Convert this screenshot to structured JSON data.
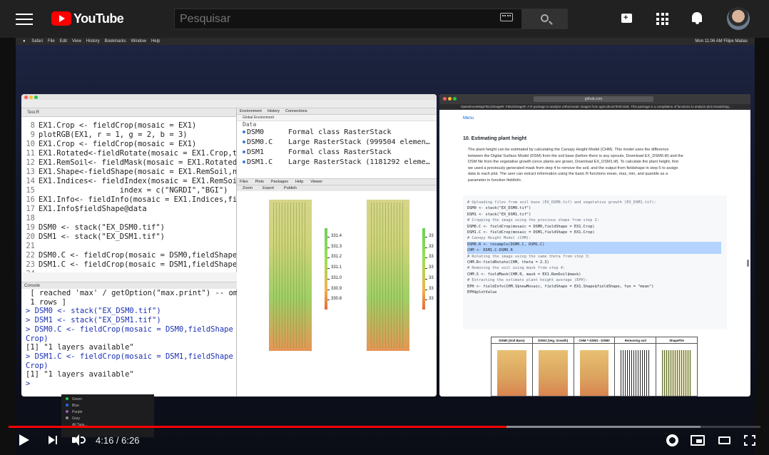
{
  "header": {
    "logo_text": "YouTube",
    "search_placeholder": "Pesquisar",
    "icons": [
      "menu-icon",
      "keyboard-icon",
      "search-icon",
      "create-video-icon",
      "apps-icon",
      "notifications-bell-icon",
      "avatar"
    ]
  },
  "mac": {
    "menubar_items": [
      "Safari",
      "File",
      "Edit",
      "View",
      "History",
      "Bookmarks",
      "Window",
      "Help"
    ],
    "clock": "Mon 11:06 AM  Filipe Matias"
  },
  "rstudio": {
    "editor_tab": "Test.R",
    "code_lines": [
      {
        "n": "8",
        "t": "EX1.Crop <- fieldCrop(mosaic = EX1)"
      },
      {
        "n": "9",
        "t": "plotRGB(EX1, r = 1, g = 2, b = 3)"
      },
      {
        "n": "10",
        "t": "EX1.Crop <- fieldCrop(mosaic = EX1)"
      },
      {
        "n": "11",
        "t": "EX1.Rotated<-fieldRotate(mosaic = EX1.Crop,theta"
      },
      {
        "n": "12",
        "t": "EX1.RemSoil<- fieldMask(mosaic = EX1.Rotated, Red"
      },
      {
        "n": "13",
        "t": "EX1.Shape<-fieldShape(mosaic = EX1.RemSoil,ncols"
      },
      {
        "n": "14",
        "t": "EX1.Indices<- fieldIndex(mosaic = EX1.RemSoil$new"
      },
      {
        "n": "15",
        "t": "                  index = c(\"NGRDI\",\"BGI\")"
      },
      {
        "n": "16",
        "t": "EX1.Info<- fieldInfo(mosaic = EX1.Indices,fieldSh"
      },
      {
        "n": "17",
        "t": "EX1.Info$fieldShape@data"
      },
      {
        "n": "18",
        "t": ""
      },
      {
        "n": "19",
        "t": "DSM0 <- stack(\"EX_DSM0.tif\")"
      },
      {
        "n": "20",
        "t": "DSM1 <- stack(\"EX_DSM1.tif\")"
      },
      {
        "n": "21",
        "t": ""
      },
      {
        "n": "22",
        "t": "DSM0.C <- fieldCrop(mosaic = DSM0,fieldShape = EX"
      },
      {
        "n": "23",
        "t": "DSM1.C <- fieldCrop(mosaic = DSM1,fieldShape = EX"
      },
      {
        "n": "24",
        "t": ""
      }
    ],
    "console_label": "Console",
    "console_lines": [
      {
        "cls": "out",
        "t": " [ reached 'max' / getOption(\"max.print\") -- omitted"
      },
      {
        "cls": "out",
        "t": " 1 rows ]"
      },
      {
        "cls": "cmd",
        "t": "> DSM0 <- stack(\"EX_DSM0.tif\")"
      },
      {
        "cls": "cmd",
        "t": "> DSM1 <- stack(\"EX_DSM1.tif\")"
      },
      {
        "cls": "cmd",
        "t": "> DSM0.C <- fieldCrop(mosaic = DSM0,fieldShape = EX1."
      },
      {
        "cls": "cmd",
        "t": "Crop)"
      },
      {
        "cls": "out",
        "t": "[1] \"1 layers available\""
      },
      {
        "cls": "cmd",
        "t": "> DSM1.C <- fieldCrop(mosaic = DSM1,fieldShape = EX1."
      },
      {
        "cls": "cmd",
        "t": "Crop)"
      },
      {
        "cls": "out",
        "t": "[1] \"1 layers available\""
      },
      {
        "cls": "cmd",
        "t": ">"
      }
    ],
    "env_tabs": [
      "Environment",
      "History",
      "Connections"
    ],
    "env_scope": "Global Environment",
    "env_section": "Data",
    "env_rows": [
      {
        "name": "DSM0",
        "value": "Formal class RasterStack"
      },
      {
        "name": "DSM0.C",
        "value": "Large RasterStack (999504 elemen…"
      },
      {
        "name": "DSM1",
        "value": "Formal class RasterStack"
      },
      {
        "name": "DSM1.C",
        "value": "Large RasterStack (1181292 eleme…"
      }
    ],
    "plot_tabs": [
      "Files",
      "Plots",
      "Packages",
      "Help",
      "Viewer"
    ],
    "plot_tools": [
      "Zoom",
      "Export",
      "Publish"
    ],
    "legend_labels": [
      "331.4",
      "331.3",
      "331.2",
      "331.1",
      "331.0",
      "330.9",
      "330.8"
    ],
    "legend_labels_right": [
      "33",
      "33",
      "33",
      "33",
      "33",
      "33",
      "33"
    ]
  },
  "safari": {
    "url": "github.com",
    "tab_title": "OpenDroneMapFIELDimageR: FIELDimageR: A R package to analyze orthomosaic images from agricultural field trials. This package is a compilation of functions to analyze plot.mosaicking...",
    "menu_link": "Menu",
    "section_title": "10. Estimating plant height",
    "para": [
      "The plant height can be estimated by calculating the Canopy Height Model (CHM). This model uses the difference",
      "between the Digital Surface Model (DSM) from the soil base (before there is any sprouts, Download EX_DSM0.tif) and the",
      "DSM file from the vegetative growth (once plants are grown, Download EX_DSM1.tif). To calculate the plant height, first",
      "we used a previously generated mask from step 4 to remove the soil, and the output from fieldshape in step 5 to assign",
      "data to each plot. The user can extract information using the basic R functions mean, max, min, and quantile as a",
      "parameter in function fieldInfo."
    ],
    "code_lines": [
      {
        "cls": "cm",
        "t": "# Uploading files from soil base (EX_DSM0.tif) and vegetative growth (EX_DSM1.tif):"
      },
      {
        "cls": "",
        "t": "DSM0 <- stack(\"EX_DSM0.tif\")"
      },
      {
        "cls": "",
        "t": "DSM1 <- stack(\"EX_DSM1.tif\")"
      },
      {
        "cls": "",
        "t": ""
      },
      {
        "cls": "cm",
        "t": "# Cropping the image using the previous shape from step 2:"
      },
      {
        "cls": "",
        "t": "DSM0.C <- fieldCrop(mosaic = DSM0,fieldShape = EX1.Crop)"
      },
      {
        "cls": "",
        "t": "DSM1.C <- fieldCrop(mosaic = DSM1,fieldShape = EX1.Crop)"
      },
      {
        "cls": "",
        "t": ""
      },
      {
        "cls": "cm",
        "t": "# Canopy Height Model (CHM):"
      },
      {
        "cls": "hl",
        "t": "DSM0.R <- resample(DSM0.C, DSM1.C)"
      },
      {
        "cls": "hl",
        "t": "CHM <- DSM1.C-DSM0.R"
      },
      {
        "cls": "",
        "t": ""
      },
      {
        "cls": "cm",
        "t": "# Rotating the image using the same theta from step 3:"
      },
      {
        "cls": "",
        "t": "CHM.R<-fieldRotate(CHM, theta = 2.3)"
      },
      {
        "cls": "",
        "t": ""
      },
      {
        "cls": "cm",
        "t": "# Removing the soil using mask from step 4:"
      },
      {
        "cls": "",
        "t": "CHM.S <- fieldMask(CHM.R, mask = EX1.RemSoil$mask)"
      },
      {
        "cls": "",
        "t": ""
      },
      {
        "cls": "cm",
        "t": "# Extracting the estimate plant height average (EPH):"
      },
      {
        "cls": "",
        "t": "EPH <- fieldInfo(CHM.S$newMosaic, fieldShape = EX1.Shape$fieldShape, fun = \"mean\")"
      },
      {
        "cls": "",
        "t": "EPH$plotValue"
      }
    ],
    "table_headers": [
      "DSM0 (Soil Base)",
      "DSM1 (Veg. Growth)",
      "CHM = DSM1 - DSM0",
      "Removing soil",
      "ShapeFile"
    ]
  },
  "color_menu": [
    {
      "label": "Green",
      "color": "#2ecc40"
    },
    {
      "label": "Blue",
      "color": "#1e6fe8"
    },
    {
      "label": "Purple",
      "color": "#9b59b6"
    },
    {
      "label": "Gray",
      "color": "#8e8e93"
    },
    {
      "label": "All Tags...",
      "color": "#1d1d1f"
    }
  ],
  "player": {
    "current_time": "4:16",
    "duration": "6:26",
    "time_text": "4:16 / 6:26",
    "progress_fraction": 0.662,
    "buffered_fraction": 0.92,
    "accent": "#ff0000",
    "icons": [
      "play-icon",
      "next-icon",
      "volume-icon",
      "settings-icon",
      "miniplayer-icon",
      "theater-mode-icon",
      "fullscreen-icon"
    ]
  }
}
